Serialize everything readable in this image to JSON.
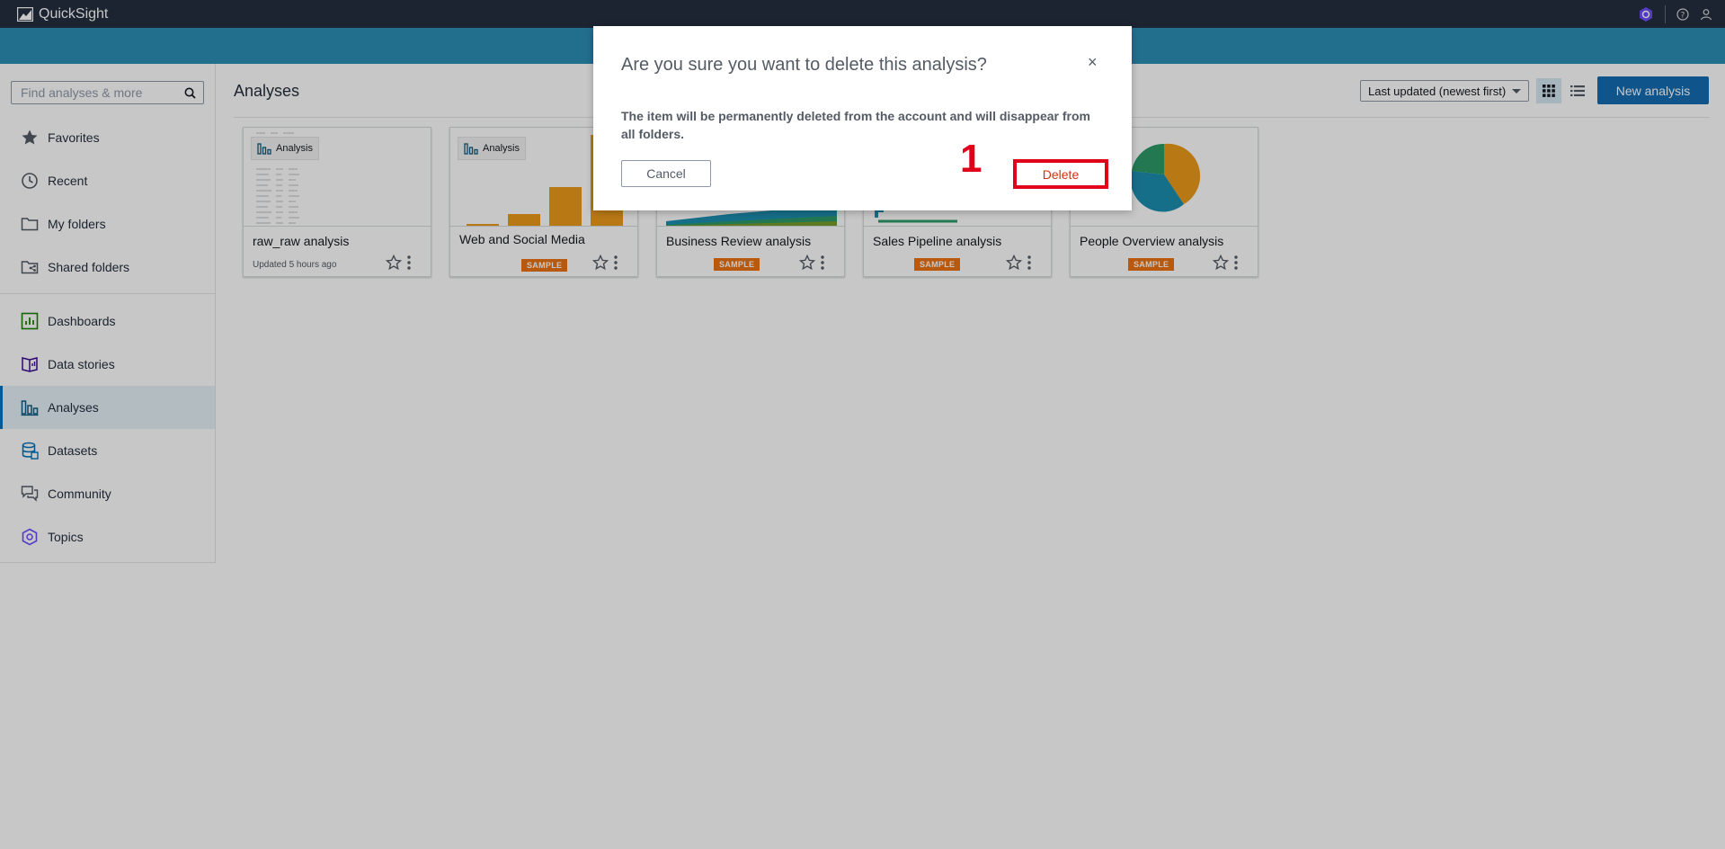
{
  "app": {
    "name": "QuickSight"
  },
  "search": {
    "placeholder": "Find analyses & more"
  },
  "sidebar": {
    "items": [
      {
        "label": "Favorites",
        "icon": "star-icon"
      },
      {
        "label": "Recent",
        "icon": "clock-icon"
      },
      {
        "label": "My folders",
        "icon": "folder-icon"
      },
      {
        "label": "Shared folders",
        "icon": "shared-folder-icon"
      },
      {
        "label": "Dashboards",
        "icon": "dashboard-icon"
      },
      {
        "label": "Data stories",
        "icon": "data-story-icon"
      },
      {
        "label": "Analyses",
        "icon": "analysis-icon",
        "active": true
      },
      {
        "label": "Datasets",
        "icon": "dataset-icon"
      },
      {
        "label": "Community",
        "icon": "community-icon"
      },
      {
        "label": "Topics",
        "icon": "topic-icon"
      }
    ]
  },
  "main": {
    "title": "Analyses",
    "sort_label": "Last updated (newest first)",
    "new_button": "New analysis",
    "cards": [
      {
        "title": "raw_raw analysis",
        "subtitle": "Updated 5 hours ago",
        "chip": "Analysis"
      },
      {
        "title": "Web and Social Media",
        "badge": "SAMPLE",
        "chip": "Analysis"
      },
      {
        "title": "Business Review analysis",
        "badge": "SAMPLE"
      },
      {
        "title": "Sales Pipeline analysis",
        "badge": "SAMPLE"
      },
      {
        "title": "People Overview analysis",
        "badge": "SAMPLE",
        "chip": "sis"
      }
    ]
  },
  "modal": {
    "title": "Are you sure you want to delete this analysis?",
    "close": "×",
    "body": "The item will be permanently deleted from the account and will disappear from all folders.",
    "cancel": "Cancel",
    "delete": "Delete",
    "step_marker": "1"
  },
  "colors": {
    "topbar": "#232f3e",
    "band": "#2b8fb5",
    "primary": "#146eb4",
    "sample": "#ec7211",
    "highlight": "#e0001a"
  }
}
